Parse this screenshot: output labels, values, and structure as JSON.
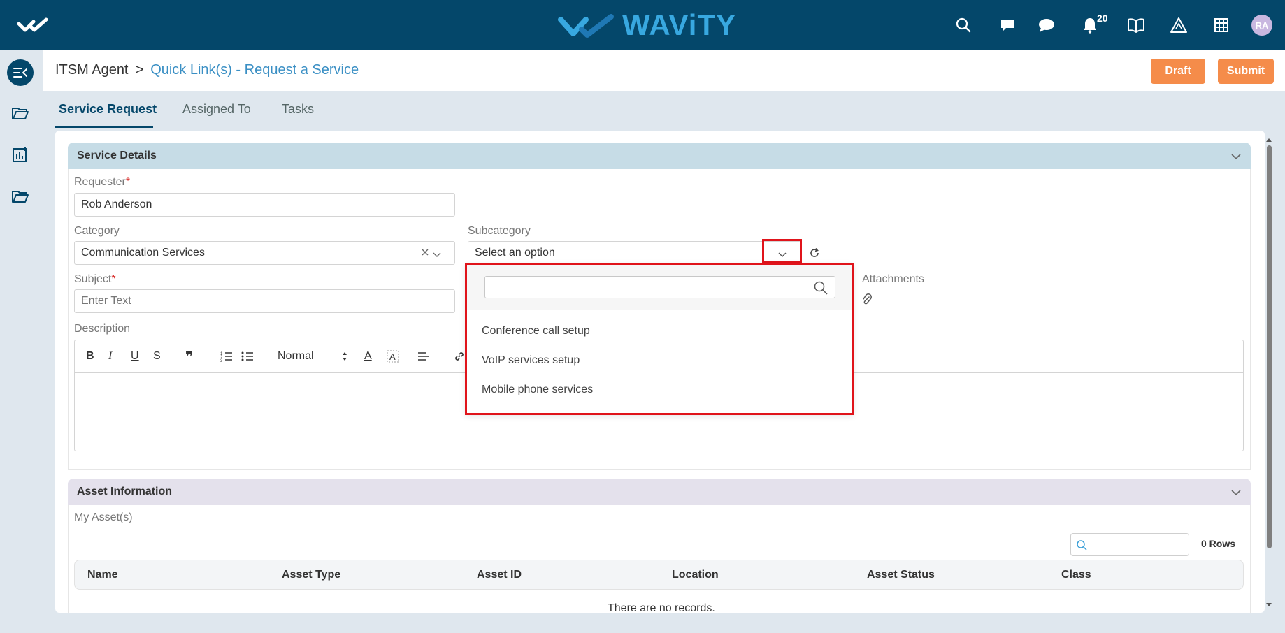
{
  "topbar": {
    "brand": "WAViTY",
    "notifications_count": "20",
    "avatar_initials": "RA"
  },
  "breadcrumb": {
    "root": "ITSM Agent",
    "separator": ">",
    "current": "Quick Link(s) - Request a Service"
  },
  "actions": {
    "draft": "Draft",
    "submit": "Submit"
  },
  "tabs": [
    {
      "label": "Service Request",
      "active": true
    },
    {
      "label": "Assigned To",
      "active": false
    },
    {
      "label": "Tasks",
      "active": false
    }
  ],
  "service_details": {
    "title": "Service Details",
    "requester_label": "Requester",
    "requester_value": "Rob Anderson",
    "category_label": "Category",
    "category_value": "Communication Services",
    "subcategory_label": "Subcategory",
    "subcategory_placeholder": "Select an option",
    "subject_label": "Subject",
    "subject_placeholder": "Enter Text",
    "attachments_label": "Attachments",
    "description_label": "Description",
    "editor_format": "Normal"
  },
  "subcategory_dropdown": {
    "search_value": "",
    "options": [
      "Conference call setup",
      "VoIP services setup",
      "Mobile phone services"
    ]
  },
  "asset_information": {
    "title": "Asset Information",
    "subtitle": "My Asset(s)",
    "rows_count": "0 Rows",
    "columns": [
      "Name",
      "Asset Type",
      "Asset ID",
      "Location",
      "Asset Status",
      "Class"
    ],
    "empty_text": "There are no records."
  },
  "colors": {
    "topbar": "#04476a",
    "accent_orange": "#f58c4a",
    "highlight_red": "#e0141b",
    "link_blue": "#3a8fc4"
  }
}
